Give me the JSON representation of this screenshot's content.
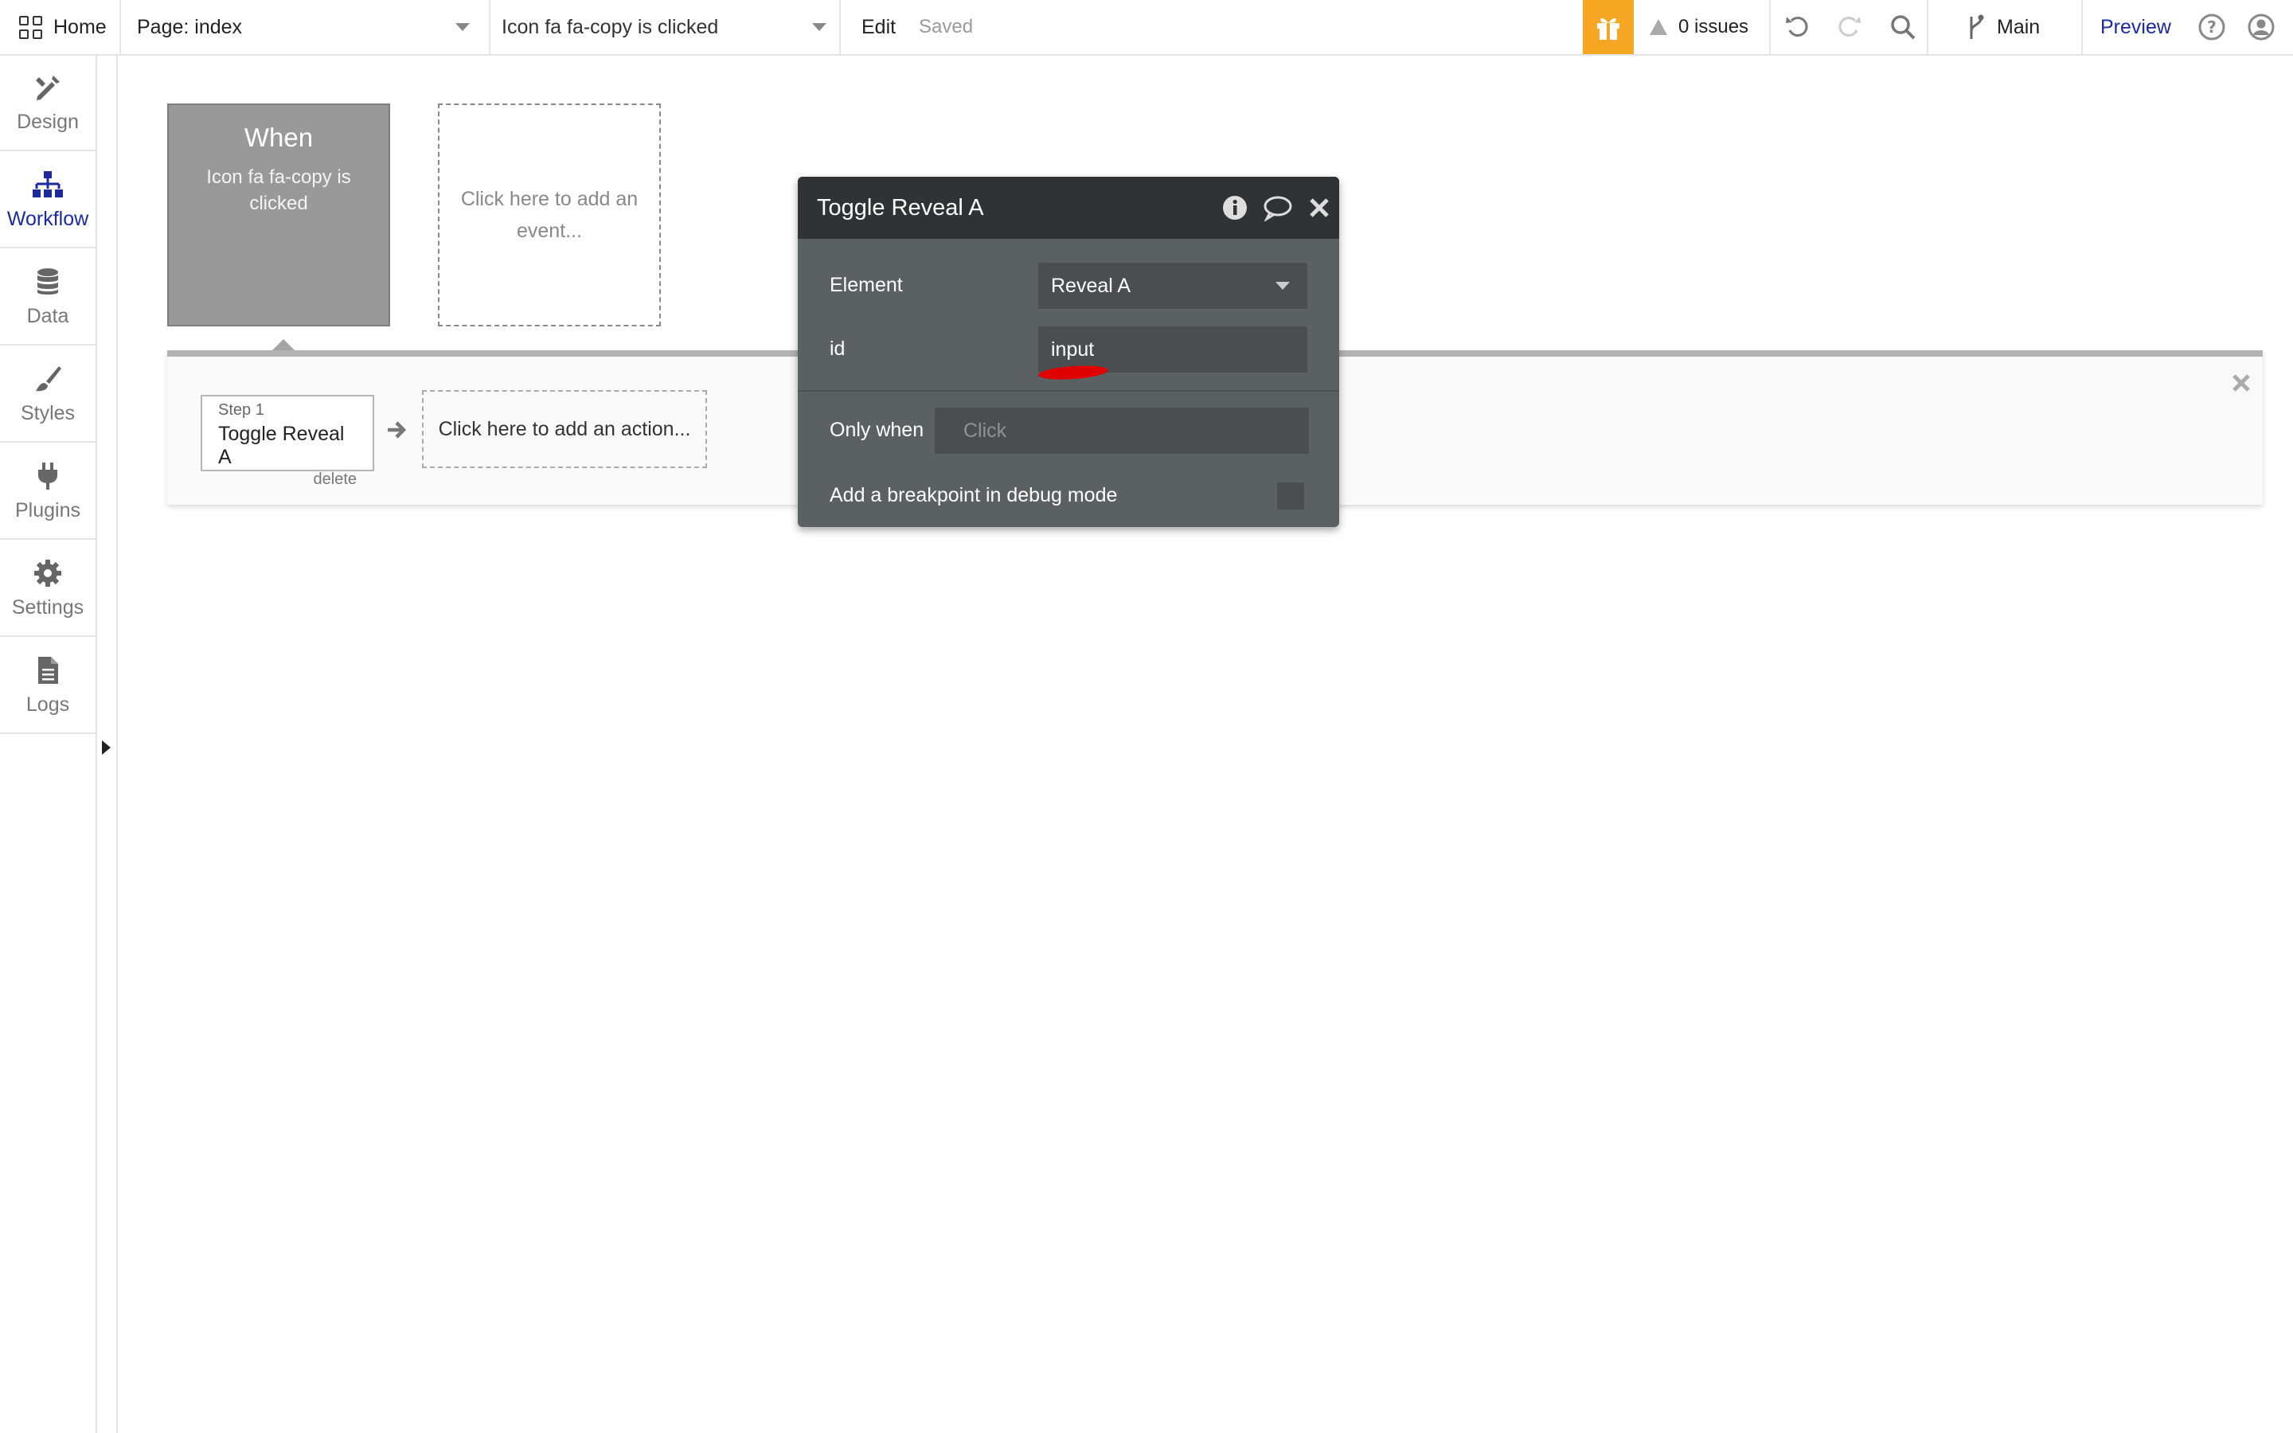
{
  "topbar": {
    "home_label": "Home",
    "page_selector": "Page: index",
    "event_selector": "Icon fa fa-copy is clicked",
    "edit_label": "Edit",
    "save_status": "Saved",
    "issues_label": "0 issues",
    "branch_label": "Main",
    "preview_label": "Preview"
  },
  "rail": {
    "items": [
      {
        "label": "Design",
        "icon": "design-icon"
      },
      {
        "label": "Workflow",
        "icon": "workflow-icon",
        "active": true
      },
      {
        "label": "Data",
        "icon": "database-icon"
      },
      {
        "label": "Styles",
        "icon": "brush-icon"
      },
      {
        "label": "Plugins",
        "icon": "plug-icon"
      },
      {
        "label": "Settings",
        "icon": "gear-icon"
      },
      {
        "label": "Logs",
        "icon": "document-icon"
      }
    ]
  },
  "workflow": {
    "when_title": "When",
    "when_description": "Icon fa fa-copy is clicked",
    "add_event": "Click here to add an event...",
    "step": {
      "number": "Step 1",
      "name": "Toggle Reveal A",
      "delete": "delete"
    },
    "add_action": "Click here to add an action..."
  },
  "editor": {
    "title": "Toggle Reveal A",
    "element_label": "Element",
    "element_value": "Reveal A",
    "id_label": "id",
    "id_value": "input",
    "only_when_label": "Only when",
    "only_when_placeholder": "Click",
    "breakpoint_label": "Add a breakpoint in debug mode"
  },
  "colors": {
    "accent": "#1b2a9e",
    "gift": "#f5a623",
    "editor_bg": "#5b6063",
    "editor_header": "#2f3335",
    "annotation": "#e00000"
  }
}
